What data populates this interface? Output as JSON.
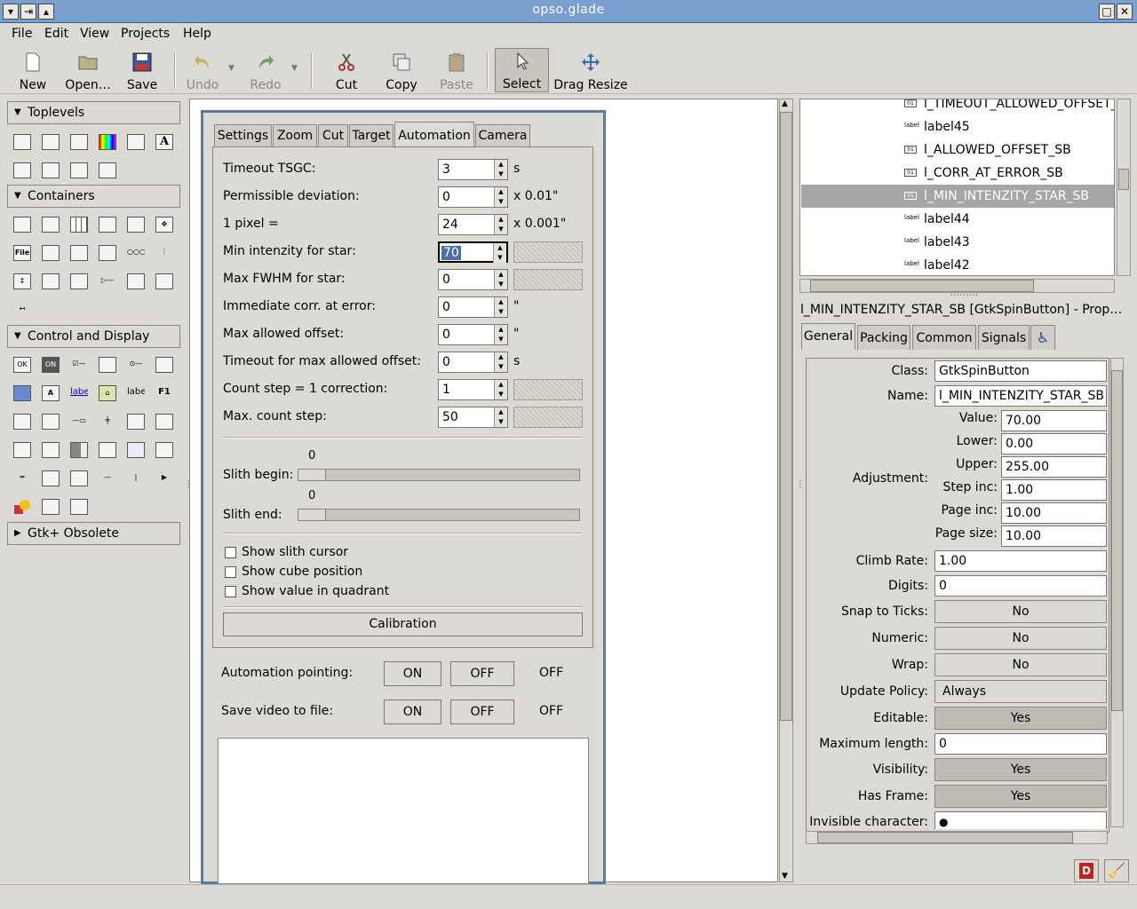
{
  "window": {
    "title": "opso.glade"
  },
  "menu": [
    {
      "label": "File"
    },
    {
      "label": "Edit"
    },
    {
      "label": "View"
    },
    {
      "label": "Projects"
    },
    {
      "label": "Help"
    }
  ],
  "toolbar": {
    "new": "New",
    "open": "Open…",
    "save": "Save",
    "undo": "Undo",
    "redo": "Redo",
    "cut": "Cut",
    "copy": "Copy",
    "paste": "Paste",
    "select": "Select",
    "drag_resize": "Drag Resize"
  },
  "palette": {
    "toplevels": "Toplevels",
    "containers": "Containers",
    "control_display": "Control and Display",
    "obsolete": "Gtk+ Obsolete",
    "glyph_a": "A",
    "glyph_file": "File",
    "glyph_ok": "OK",
    "glyph_on": "ON",
    "glyph_label_link": "label",
    "glyph_label": "label",
    "glyph_f1": "F1"
  },
  "design": {
    "tabs": [
      {
        "label": "Settings"
      },
      {
        "label": "Zoom"
      },
      {
        "label": "Cut"
      },
      {
        "label": "Target"
      },
      {
        "label": "Automation"
      },
      {
        "label": "Camera"
      }
    ],
    "rows": [
      {
        "label": "Timeout TSGC:",
        "value": "3",
        "unit": "s"
      },
      {
        "label": "Permissible deviation:",
        "value": "0",
        "unit": "x 0.01\""
      },
      {
        "label": "1 pixel =",
        "value": "24",
        "unit": "x 0.001\""
      },
      {
        "label": "Min intenzity for star:",
        "value": "70",
        "unit": ""
      },
      {
        "label": "Max FWHM for star:",
        "value": "0",
        "unit": ""
      },
      {
        "label": "Immediate corr. at error:",
        "value": "0",
        "unit": "\""
      },
      {
        "label": "Max allowed offset:",
        "value": "0",
        "unit": "\""
      },
      {
        "label": "Timeout for max allowed offset:",
        "value": "0",
        "unit": "s"
      },
      {
        "label": "Count step = 1 correction:",
        "value": "1",
        "unit": ""
      },
      {
        "label": "Max. count step:",
        "value": "50",
        "unit": ""
      }
    ],
    "slith_begin": {
      "label": "Slith begin:",
      "value": "0"
    },
    "slith_end": {
      "label": "Slith end:",
      "value": "0"
    },
    "checks": [
      {
        "label": "Show slith cursor"
      },
      {
        "label": "Show cube position"
      },
      {
        "label": "Show value in quadrant"
      }
    ],
    "calibration": "Calibration",
    "automation_pointing": {
      "label": "Automation pointing:",
      "on": "ON",
      "off": "OFF",
      "state": "OFF"
    },
    "save_video": {
      "label": "Save video to file:",
      "on": "ON",
      "off": "OFF",
      "state": "OFF"
    }
  },
  "tree": {
    "items": [
      {
        "label": "l_TIMEOUT_ALLOWED_OFFSET_",
        "icon": "spin"
      },
      {
        "label": "label45",
        "icon": "label"
      },
      {
        "label": "l_ALLOWED_OFFSET_SB",
        "icon": "spin"
      },
      {
        "label": "l_CORR_AT_ERROR_SB",
        "icon": "spin"
      },
      {
        "label": "l_MIN_INTENZITY_STAR_SB",
        "icon": "spin"
      },
      {
        "label": "label44",
        "icon": "label"
      },
      {
        "label": "label43",
        "icon": "label"
      },
      {
        "label": "label42",
        "icon": "label"
      }
    ],
    "selected_index": 4,
    "icon_spin": "01",
    "icon_label": "label"
  },
  "props": {
    "title": "l_MIN_INTENZITY_STAR_SB [GtkSpinButton] - Prop…",
    "tabs": [
      {
        "label": "General"
      },
      {
        "label": "Packing"
      },
      {
        "label": "Common"
      },
      {
        "label": "Signals"
      }
    ],
    "class_label": "Class:",
    "class_value": "GtkSpinButton",
    "name_label": "Name:",
    "name_value": "l_MIN_INTENZITY_STAR_SB",
    "adjustment_label": "Adjustment:",
    "adjustment": [
      {
        "label": "Value:",
        "value": "70.00"
      },
      {
        "label": "Lower:",
        "value": "0.00"
      },
      {
        "label": "Upper:",
        "value": "255.00"
      },
      {
        "label": "Step inc:",
        "value": "1.00"
      },
      {
        "label": "Page inc:",
        "value": "10.00"
      },
      {
        "label": "Page size:",
        "value": "10.00"
      }
    ],
    "climb_label": "Climb Rate:",
    "climb_value": "1.00",
    "digits_label": "Digits:",
    "digits_value": "0",
    "snap_label": "Snap to Ticks:",
    "snap_value": "No",
    "numeric_label": "Numeric:",
    "numeric_value": "No",
    "wrap_label": "Wrap:",
    "wrap_value": "No",
    "update_label": "Update Policy:",
    "update_value": "Always",
    "editable_label": "Editable:",
    "editable_value": "Yes",
    "maxlen_label": "Maximum length:",
    "maxlen_value": "0",
    "visibility_label": "Visibility:",
    "visibility_value": "Yes",
    "frame_label": "Has Frame:",
    "frame_value": "Yes",
    "invisible_label": "Invisible character:",
    "invisible_value": "●"
  },
  "bottom_icons": {
    "d_glyph": "D"
  }
}
